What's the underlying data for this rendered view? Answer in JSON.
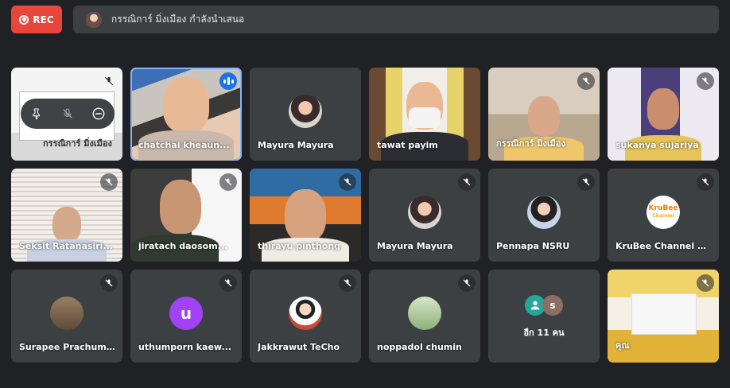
{
  "recording": {
    "label": "REC"
  },
  "presenter_bar": {
    "text": "กรรณิการ์ มิ่งเมือง กำลังนำเสนอ"
  },
  "tiles": [
    {
      "name": "กรรณิการ์ มิ่งเมือง",
      "mic": "muted"
    },
    {
      "name": "chatchai kheaun...",
      "mic": "speaking"
    },
    {
      "name": "Mayura Mayura",
      "mic": "none"
    },
    {
      "name": "tawat payim",
      "mic": "none"
    },
    {
      "name": "กรรณิการ์ มิ่งเมือง",
      "mic": "muted"
    },
    {
      "name": "sukanya sujariya",
      "mic": "muted"
    },
    {
      "name": "Seksit Ratanasiri...",
      "mic": "muted"
    },
    {
      "name": "jiratach daosom...",
      "mic": "muted"
    },
    {
      "name": "thirayu pinthong",
      "mic": "muted"
    },
    {
      "name": "Mayura Mayura",
      "mic": "muted"
    },
    {
      "name": "Pennapa NSRU",
      "mic": "muted"
    },
    {
      "name": "KruBee Channel R...",
      "mic": "muted"
    },
    {
      "name": "Surapee Prachum...",
      "mic": "muted"
    },
    {
      "name": "uthumporn kaew...",
      "mic": "muted"
    },
    {
      "name": "Jakkrawut TeCho",
      "mic": "muted"
    },
    {
      "name": "noppadol chumin",
      "mic": "muted"
    },
    {
      "name": "อีก 11 คน",
      "mic": "none"
    },
    {
      "name": "คุณ",
      "mic": "muted"
    }
  ],
  "avatar_letters": {
    "uthumporn": "u",
    "others_second": "s"
  },
  "logo": {
    "line1": "KruBee",
    "line2": "Channel"
  },
  "icons": {
    "pin": "pin-icon",
    "mute_toggle": "mic-off-icon",
    "remove": "minus-circle-icon",
    "mic_off": "mic-off-icon",
    "speaking": "audio-level-icon",
    "rec": "record-icon"
  },
  "colors": {
    "background": "#202124",
    "tile": "#3c4043",
    "rec": "#e8453c",
    "accent": "#1a73e8"
  }
}
